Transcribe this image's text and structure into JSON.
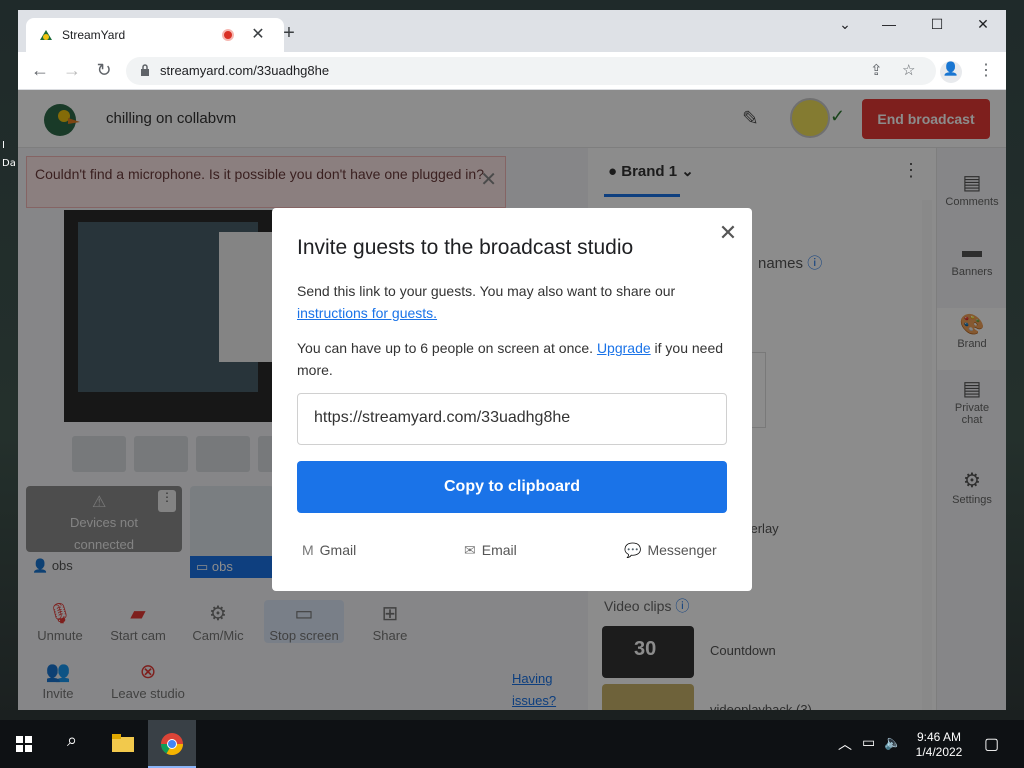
{
  "desktop": {
    "side_text": "Da"
  },
  "browser": {
    "tab_title": "StreamYard",
    "tab_close": "✕",
    "new_tab": "+",
    "minimize": "—",
    "maximize": "☐",
    "close": "✕",
    "url": "streamyard.com/33uadhg8he"
  },
  "studio": {
    "broadcast_name": "chilling on collabvm",
    "end_button": "End broadcast",
    "mic_warning": "Couldn't find a microphone. Is it possible you don't have one plugged in?",
    "warning_close": "✕",
    "source_cards": {
      "devices_line1": "Devices not",
      "devices_line2": "connected",
      "label1": "obs",
      "label2": "obs"
    },
    "controls": {
      "unmute": "Unmute",
      "start_cam": "Start cam",
      "cam_mic": "Cam/Mic",
      "stop_screen": "Stop screen",
      "share": "Share",
      "invite": "Invite",
      "leave": "Leave studio"
    },
    "help_link_line1": "Having",
    "help_link_line2": "issues?"
  },
  "brand_panel": {
    "tab": "Brand 1",
    "names_text": "names",
    "overlay_text": "verlay",
    "video_clips": "Video clips",
    "clips": [
      {
        "label": "Countdown",
        "thumb_text": "30"
      },
      {
        "label": "videoplayback (3)",
        "thumb_text": ""
      }
    ]
  },
  "right_menu": {
    "comments": "Comments",
    "banners": "Banners",
    "brand": "Brand",
    "private_chat_1": "Private",
    "private_chat_2": "chat",
    "settings": "Settings"
  },
  "modal": {
    "title": "Invite guests to the broadcast studio",
    "p1_text": "Send this link to your guests. You may also want to share our ",
    "p1_link": "instructions for guests.",
    "p2_text": "You can have up to 6 people on screen at once. ",
    "p2_link": "Upgrade",
    "p2_suffix": " if you need more.",
    "invite_url": "https://streamyard.com/33uadhg8he",
    "copy_button": "Copy to clipboard",
    "share_gmail": "Gmail",
    "share_email": "Email",
    "share_messenger": "Messenger"
  },
  "taskbar": {
    "time": "9:46 AM",
    "date": "1/4/2022"
  },
  "colors": {
    "primary": "#1a73e8",
    "end_broadcast": "#e53935"
  }
}
